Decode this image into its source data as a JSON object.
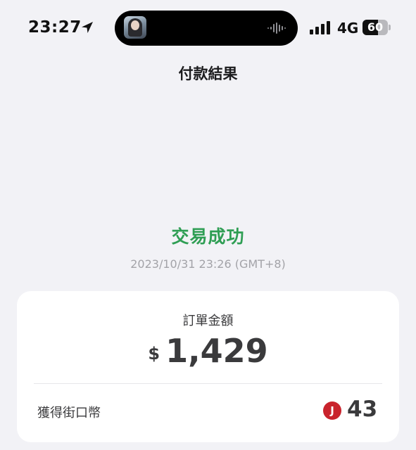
{
  "status_bar": {
    "time": "23:27",
    "network": "4G",
    "battery_percent": "60",
    "battery_level": 0.6,
    "icons": {
      "location": "location-arrow-icon",
      "waveform": "audio-waveform-icon",
      "signal": "cellular-signal-icon"
    }
  },
  "header": {
    "title": "付款結果"
  },
  "result": {
    "status": "交易成功",
    "timestamp": "2023/10/31 23:26 (GMT+8)",
    "status_color": "#2f9e54"
  },
  "summary_card": {
    "order_amount_label": "訂單金額",
    "currency_symbol": "$",
    "order_amount": "1,429",
    "coins_label": "獲得街口幣",
    "coin_badge": "J",
    "coins_earned": "43",
    "coin_badge_color": "#c9232c"
  }
}
